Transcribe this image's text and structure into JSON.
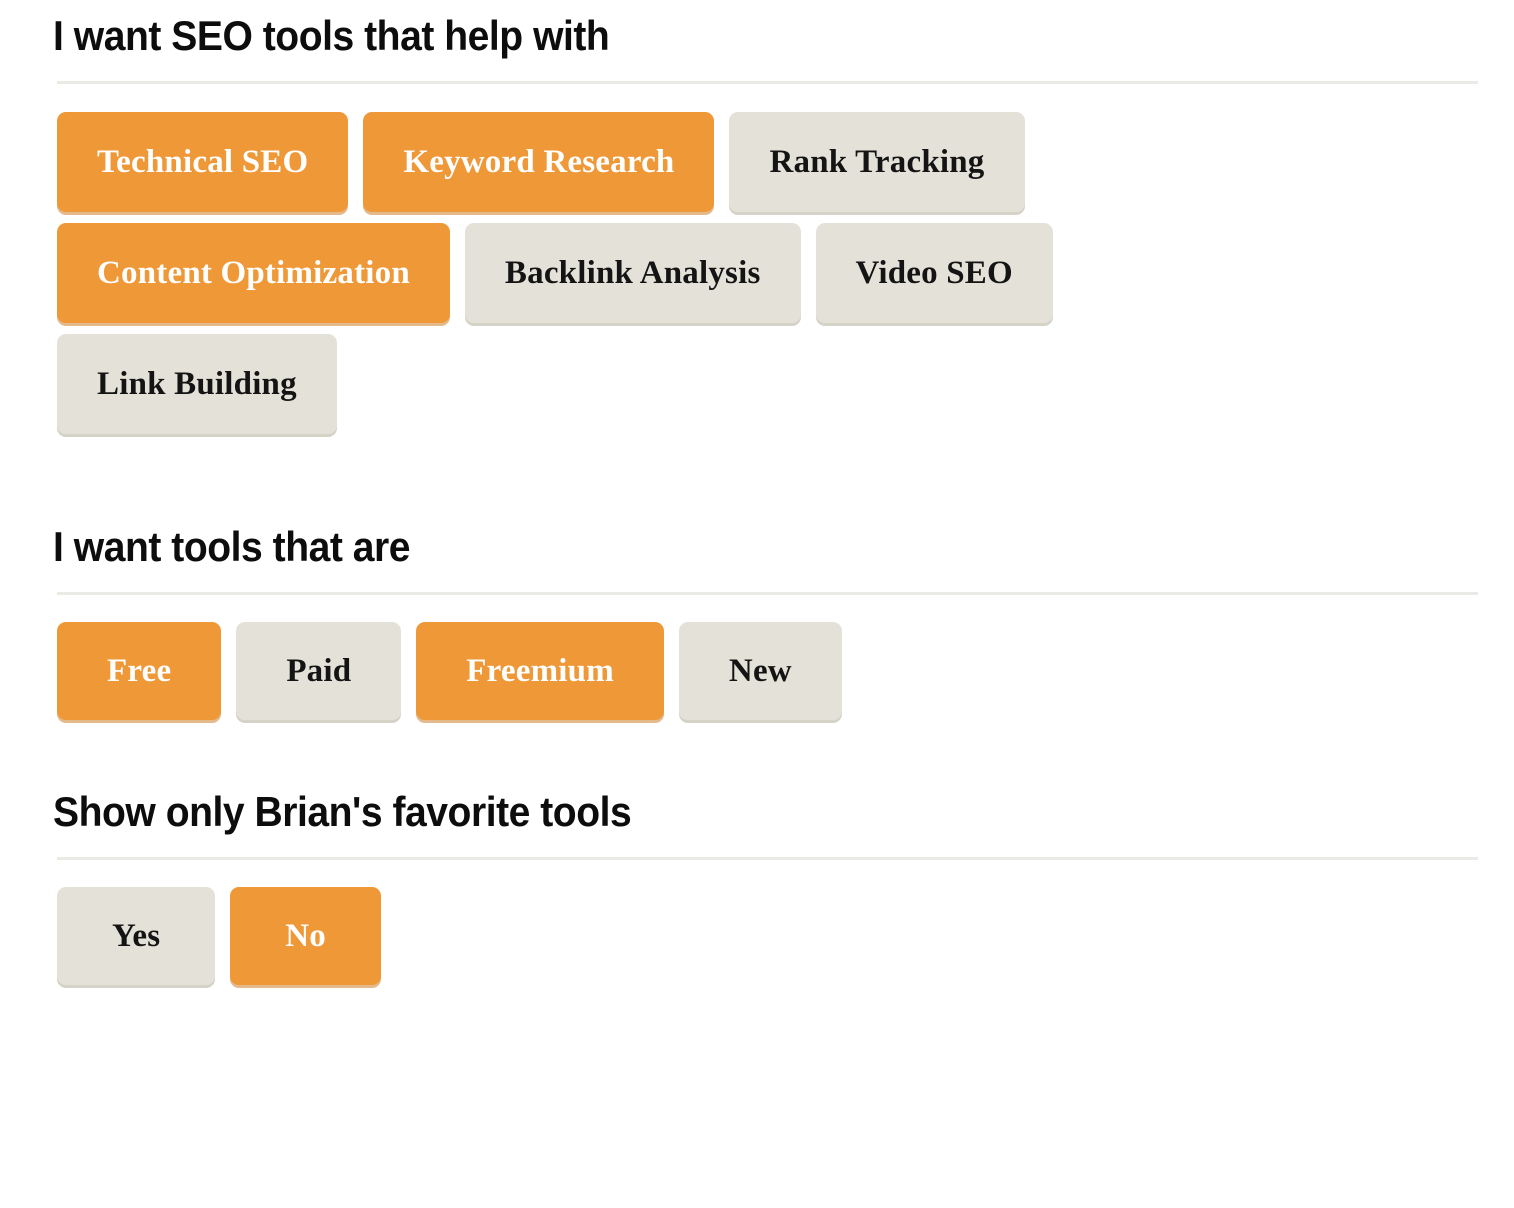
{
  "sections": [
    {
      "id": "help-with",
      "heading": "I want SEO tools that help with",
      "rows": [
        [
          {
            "label": "Technical SEO",
            "state": "active"
          },
          {
            "label": "Keyword Research",
            "state": "active"
          },
          {
            "label": "Rank Tracking",
            "state": "inactive"
          }
        ],
        [
          {
            "label": "Content Optimization",
            "state": "active"
          },
          {
            "label": "Backlink Analysis",
            "state": "inactive"
          },
          {
            "label": "Video SEO",
            "state": "inactive"
          }
        ],
        [
          {
            "label": "Link Building",
            "state": "inactive"
          }
        ]
      ]
    },
    {
      "id": "pricing",
      "heading": "I want tools that are",
      "rows": [
        [
          {
            "label": "Free",
            "state": "active"
          },
          {
            "label": "Paid",
            "state": "inactive"
          },
          {
            "label": "Freemium",
            "state": "active"
          },
          {
            "label": "New",
            "state": "inactive"
          }
        ]
      ]
    },
    {
      "id": "favorites",
      "heading": "Show only Brian's favorite tools",
      "rows": [
        [
          {
            "label": "Yes",
            "state": "inactive"
          },
          {
            "label": "No",
            "state": "active"
          }
        ]
      ]
    }
  ],
  "colors": {
    "active_background": "#ef9837",
    "active_text": "#ffffff",
    "inactive_background": "#e4e2d8",
    "inactive_text": "#141414",
    "divider": "#eceae4",
    "page_background": "#ffffff",
    "heading_text": "#0d0d0d"
  }
}
